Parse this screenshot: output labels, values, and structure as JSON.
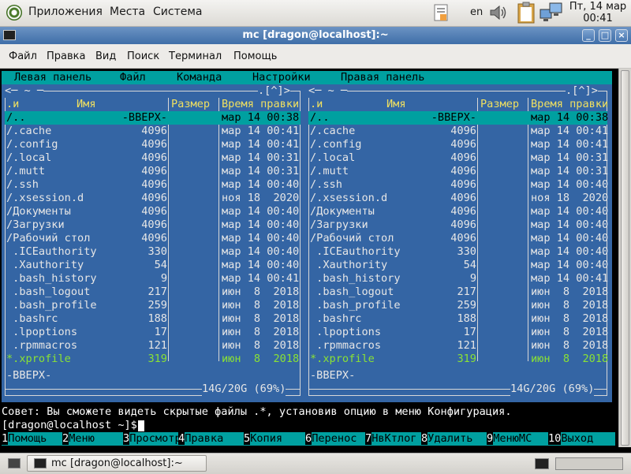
{
  "top_panel": {
    "menus": [
      "Приложения",
      "Места",
      "Система"
    ],
    "keyboard_layout": "en",
    "clock": {
      "line1": "Пт, 14 мар",
      "line2": "00:41"
    }
  },
  "window": {
    "title": "mc [dragon@localhost]:~"
  },
  "terminal_menu": [
    "Файл",
    "Правка",
    "Вид",
    "Поиск",
    "Терминал",
    "Помощь"
  ],
  "mc": {
    "menubar": [
      "Левая панель",
      "Файл",
      "Команда",
      "Настройки",
      "Правая панель"
    ],
    "left_panel": {
      "top_left": "<─ ~ ─",
      "top_right": ".[^]>",
      "columns": {
        "sort": ".и",
        "name": "Имя",
        "size": "Размер",
        "mtime": "Время правки"
      },
      "footer_info": "-ВВЕРХ-",
      "disk": "14G/20G (69%)"
    },
    "right_panel": {
      "top_left": "<─ ~ ─",
      "top_right": ".[^]>",
      "columns": {
        "sort": ".и",
        "name": "Имя",
        "size": "Размер",
        "mtime": "Время правки"
      },
      "footer_info": "-ВВЕРХ-",
      "disk": "14G/20G (69%)"
    },
    "files": [
      {
        "name": "/..",
        "size": "-ВВЕРХ-",
        "mtime": "мар 14 00:38"
      },
      {
        "name": "/.cache",
        "size": "4096",
        "mtime": "мар 14 00:41"
      },
      {
        "name": "/.config",
        "size": "4096",
        "mtime": "мар 14 00:41"
      },
      {
        "name": "/.local",
        "size": "4096",
        "mtime": "мар 14 00:31"
      },
      {
        "name": "/.mutt",
        "size": "4096",
        "mtime": "мар 14 00:31"
      },
      {
        "name": "/.ssh",
        "size": "4096",
        "mtime": "мар 14 00:40"
      },
      {
        "name": "/.xsession.d",
        "size": "4096",
        "mtime": "ноя 18  2020"
      },
      {
        "name": "/Документы",
        "size": "4096",
        "mtime": "мар 14 00:40"
      },
      {
        "name": "/Загрузки",
        "size": "4096",
        "mtime": "мар 14 00:40"
      },
      {
        "name": "/Рабочий стол",
        "size": "4096",
        "mtime": "мар 14 00:40"
      },
      {
        "name": " .ICEauthority",
        "size": "330",
        "mtime": "мар 14 00:40"
      },
      {
        "name": " .Xauthority",
        "size": "54",
        "mtime": "мар 14 00:40"
      },
      {
        "name": " .bash_history",
        "size": "9",
        "mtime": "мар 14 00:41"
      },
      {
        "name": " .bash_logout",
        "size": "217",
        "mtime": "июн  8  2018"
      },
      {
        "name": " .bash_profile",
        "size": "259",
        "mtime": "июн  8  2018"
      },
      {
        "name": " .bashrc",
        "size": "188",
        "mtime": "июн  8  2018"
      },
      {
        "name": " .lpoptions",
        "size": "17",
        "mtime": "июн  8  2018"
      },
      {
        "name": " .rpmmacros",
        "size": "121",
        "mtime": "июн  8  2018"
      },
      {
        "name": "*.xprofile",
        "size": "319",
        "mtime": "июн  8  2018",
        "executable": true
      }
    ],
    "hint": "Совет: Вы сможете видеть скрытые файлы .*, установив опцию в меню Конфигурация.",
    "prompt": "[dragon@localhost ~]$ ",
    "fkeys": [
      {
        "num": "1",
        "label": "Помощь"
      },
      {
        "num": "2",
        "label": "Меню"
      },
      {
        "num": "3",
        "label": "Просмотр"
      },
      {
        "num": "4",
        "label": "Правка"
      },
      {
        "num": "5",
        "label": "Копия"
      },
      {
        "num": "6",
        "label": "Перенос"
      },
      {
        "num": "7",
        "label": "НвКтлог"
      },
      {
        "num": "8",
        "label": "Удалить"
      },
      {
        "num": "9",
        "label": "МенюМС"
      },
      {
        "num": "10",
        "label": "Выход"
      }
    ]
  },
  "taskbar": {
    "task_label": "mc [dragon@localhost]:~"
  }
}
